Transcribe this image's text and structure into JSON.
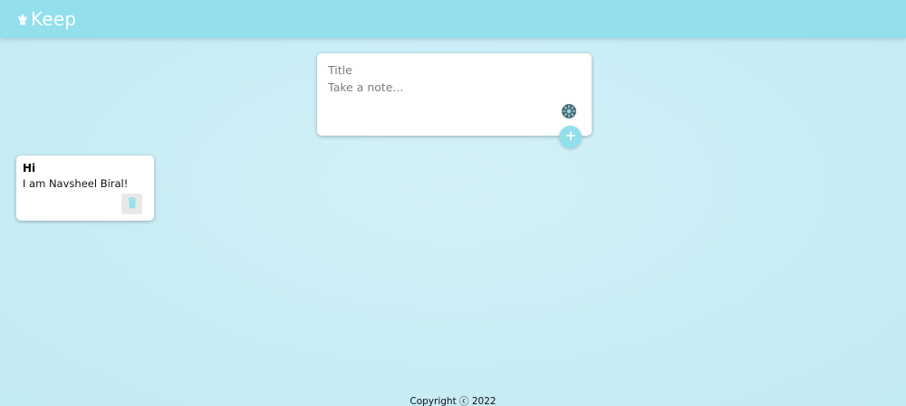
{
  "header": {
    "logo_icon": "highlight-icon",
    "app_name": "Keep",
    "bg_color": "#93dfec"
  },
  "create_note": {
    "title_placeholder": "Title",
    "content_placeholder": "Take a note...",
    "palette_icon": "spinner-icon",
    "add_icon": "plus-icon",
    "accent_color": "#93dfec"
  },
  "notes": [
    {
      "title": "Hi",
      "content": "I am Navsheel Biral!",
      "delete_icon": "trash-icon"
    }
  ],
  "footer": {
    "copyright": "Copyright ⓒ 2022"
  }
}
